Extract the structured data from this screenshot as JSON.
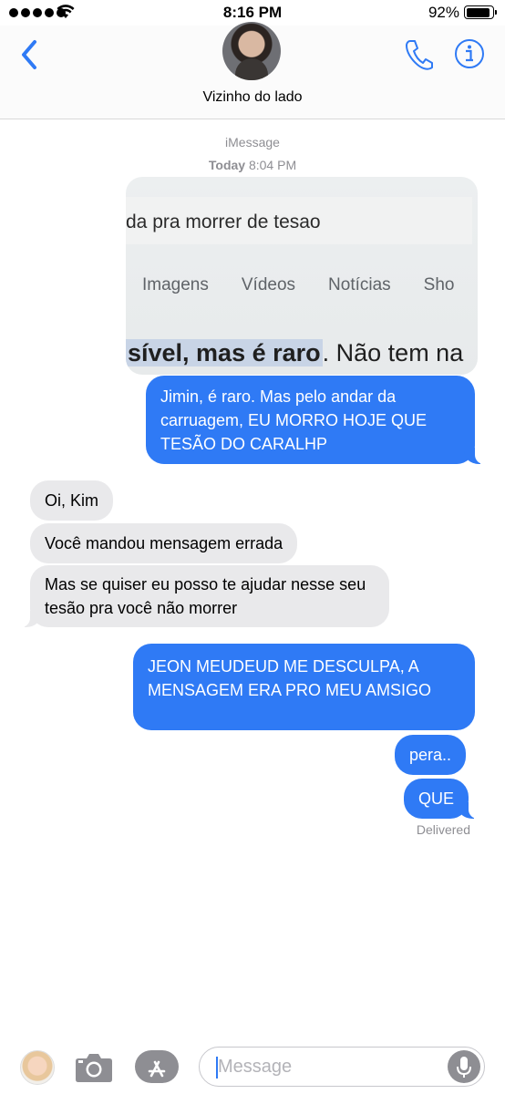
{
  "status_bar": {
    "time": "8:16 PM",
    "battery_percent": "92%",
    "battery_level": 0.92,
    "signal_bars": 5,
    "icons": [
      "signal-dots-icon",
      "wifi-icon",
      "battery-icon"
    ]
  },
  "header": {
    "contact_name": "Vizinho do lado",
    "icons": [
      "back-chevron-icon",
      "phone-icon",
      "info-icon"
    ]
  },
  "conversation": {
    "service": "iMessage",
    "timestamp_prefix": "Today",
    "timestamp_time": "8:04 PM",
    "image_message": {
      "query_text": "da pra morrer de tesao",
      "tabs": [
        "Imagens",
        "Vídeos",
        "Notícias",
        "Sho"
      ],
      "result_highlight": "sível, mas é raro",
      "result_rest": ". Não tem na"
    },
    "messages": [
      {
        "from": "me",
        "text": "Jimin, é raro. Mas pelo andar da carruagem, EU MORRO HOJE QUE TESÃO DO CARALHP"
      },
      {
        "from": "contact",
        "text": "Oi, Kim"
      },
      {
        "from": "contact",
        "text": "Você mandou mensagem errada"
      },
      {
        "from": "contact",
        "text": "Mas se quiser eu posso te ajudar nesse seu tesão pra você não morrer"
      },
      {
        "from": "me",
        "text": "JEON MEUDEUD ME DESCULPA, A MENSAGEM ERA PRO MEU AMSIGO"
      },
      {
        "from": "me",
        "text": "pera.."
      },
      {
        "from": "me",
        "text": "QUE"
      }
    ],
    "delivery_status": "Delivered"
  },
  "input_bar": {
    "placeholder": "Message",
    "icons": [
      "memoji-icon",
      "camera-icon",
      "app-store-icon",
      "microphone-icon"
    ]
  },
  "colors": {
    "sent_bubble": "#2f7af5",
    "received_bubble": "#e9e9eb",
    "accent": "#2f7af5",
    "meta_text": "#8e8e93"
  }
}
